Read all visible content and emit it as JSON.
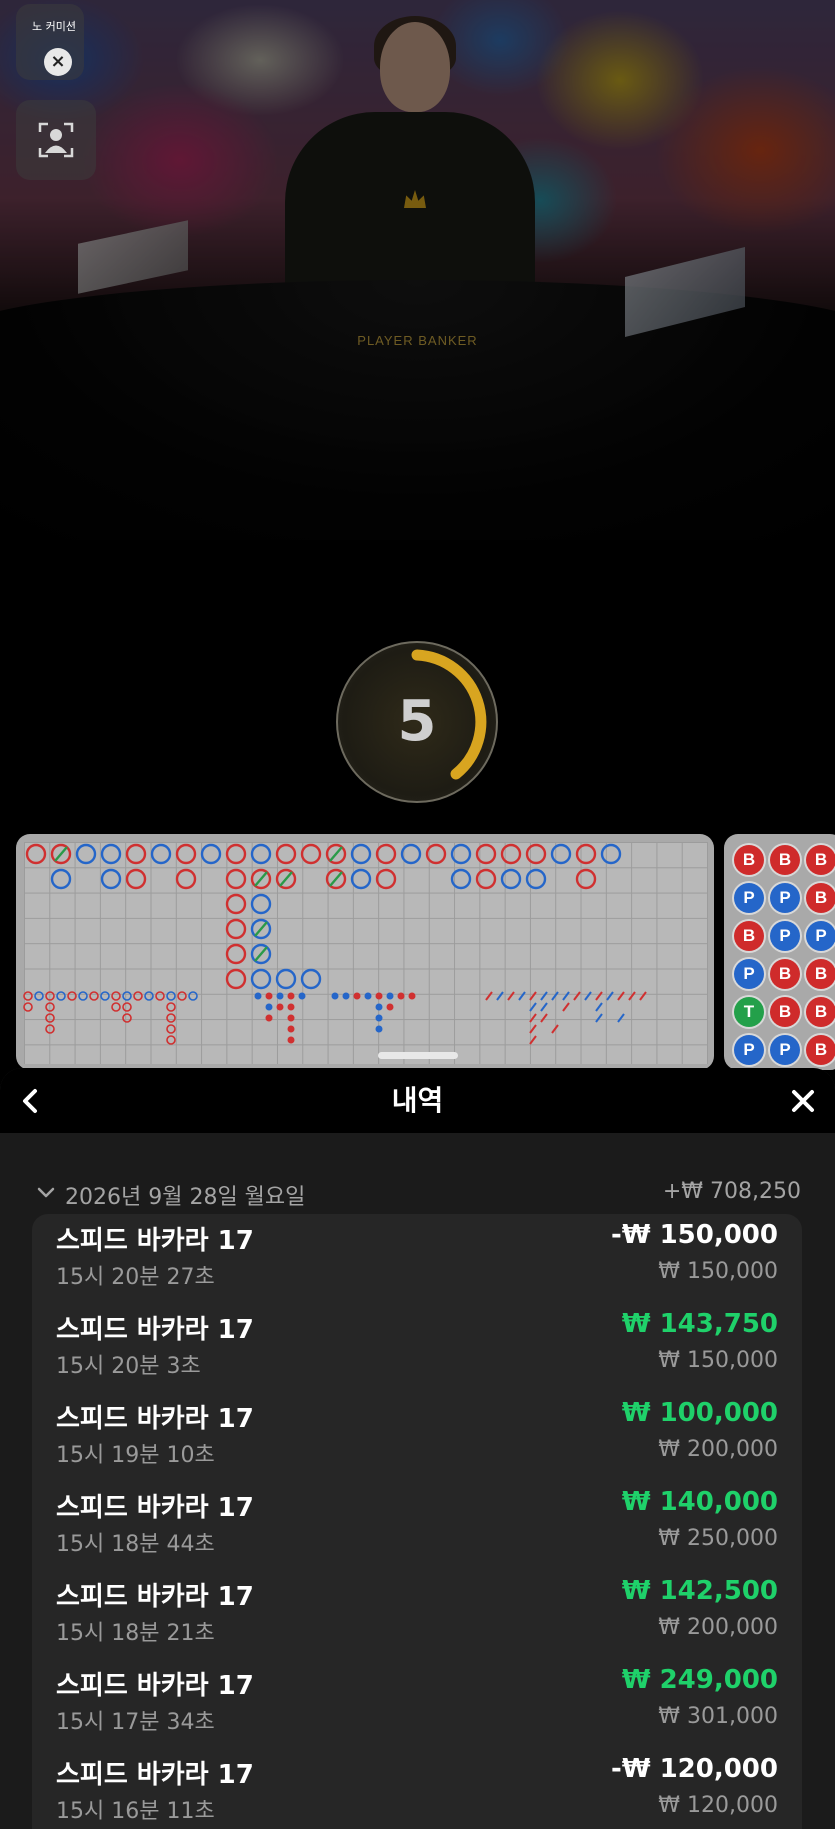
{
  "video": {
    "no_commission_label": "노 커미션",
    "table_label": "PLAYER BANKER",
    "countdown": "5"
  },
  "icons": {
    "close": "close-icon",
    "avatar": "user-icon",
    "back": "chevron-left-icon",
    "sheet_close": "close-icon",
    "collapse": "chevron-down-icon"
  },
  "colors": {
    "banker": "#cf2b2b",
    "player": "#2566c9",
    "tie": "#23a04a",
    "win": "#1fd16a"
  },
  "bead_road": [
    [
      "B",
      "B",
      "B"
    ],
    [
      "P",
      "P",
      "B"
    ],
    [
      "B",
      "P",
      "P"
    ],
    [
      "P",
      "B",
      "B"
    ],
    [
      "T",
      "B",
      "B"
    ],
    [
      "P",
      "P",
      "B"
    ]
  ],
  "sheet": {
    "title": "내역",
    "date": "2026년 9월 28일 월요일",
    "date_total": "+₩ 708,250",
    "items": [
      {
        "game": "스피드 바카라 17",
        "time": "15시 20분 27초",
        "result": "-₩ 150,000",
        "stake": "₩ 150,000",
        "win": false
      },
      {
        "game": "스피드 바카라 17",
        "time": "15시 20분 3초",
        "result": "₩ 143,750",
        "stake": "₩ 150,000",
        "win": true
      },
      {
        "game": "스피드 바카라 17",
        "time": "15시 19분 10초",
        "result": "₩ 100,000",
        "stake": "₩ 200,000",
        "win": true
      },
      {
        "game": "스피드 바카라 17",
        "time": "15시 18분 44초",
        "result": "₩ 140,000",
        "stake": "₩ 250,000",
        "win": true
      },
      {
        "game": "스피드 바카라 17",
        "time": "15시 18분 21초",
        "result": "₩ 142,500",
        "stake": "₩ 200,000",
        "win": true
      },
      {
        "game": "스피드 바카라 17",
        "time": "15시 17분 34초",
        "result": "₩ 249,000",
        "stake": "₩ 301,000",
        "win": true
      },
      {
        "game": "스피드 바카라 17",
        "time": "15시 16분 11초",
        "result": "-₩ 120,000",
        "stake": "₩ 120,000",
        "win": false
      }
    ]
  }
}
